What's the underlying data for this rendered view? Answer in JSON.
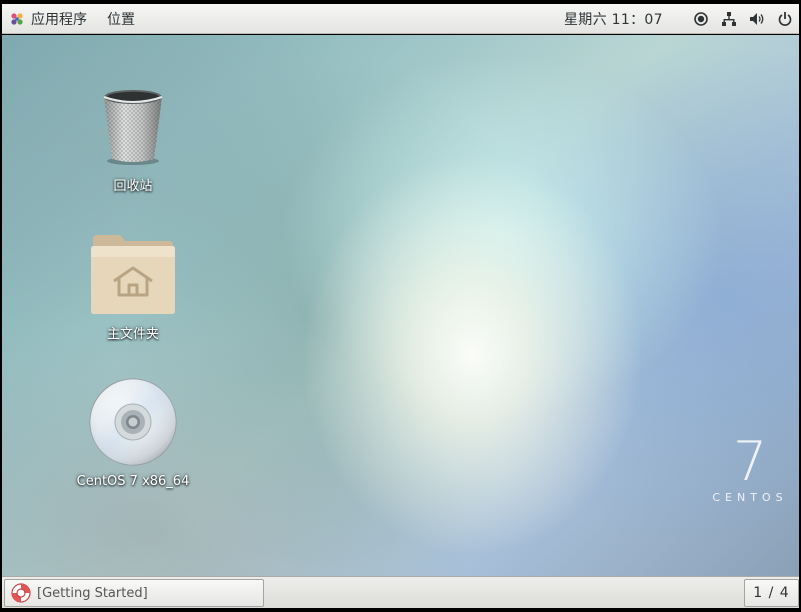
{
  "topbar": {
    "applications_label": "应用程序",
    "places_label": "位置",
    "clock": "星期六 11：07",
    "tray_icons": [
      "accessibility-icon",
      "network-icon",
      "volume-icon",
      "power-icon"
    ]
  },
  "desktop": {
    "icons": [
      {
        "name": "trash",
        "label": "回收站"
      },
      {
        "name": "home-folder",
        "label": "主文件夹"
      },
      {
        "name": "cdrom",
        "label": "CentOS 7 x86_64"
      }
    ],
    "branding": {
      "number": "7",
      "word": "CENTOS"
    }
  },
  "taskbar": {
    "window_label": "[Getting Started]",
    "workspace": "1 / 4"
  },
  "colors": {
    "panel": "#e9e9e7",
    "panel_text": "#2e3436"
  }
}
